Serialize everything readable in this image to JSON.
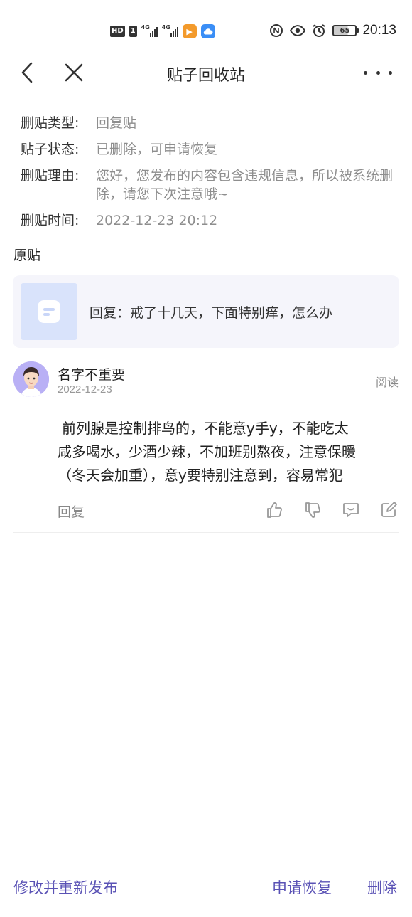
{
  "status_bar": {
    "hd_label": "HD",
    "sim_label": "1",
    "signal_1_label": "4G",
    "signal_2_label": "4G",
    "time": "20:13",
    "battery": "65",
    "icons": [
      "hd-icon",
      "signal-icon",
      "video-app-icon",
      "cloud-icon",
      "nfc-icon",
      "eye-icon",
      "alarm-icon",
      "battery-icon"
    ]
  },
  "nav": {
    "title": "贴子回收站"
  },
  "info": {
    "type_label": "删贴类型:",
    "type_value": "回复贴",
    "status_label": "贴子状态:",
    "status_value": "已删除，可申请恢复",
    "reason_label": "删贴理由:",
    "reason_value": "您好，您发布的内容包含违规信息，所以被系统删除，请您下次注意哦~",
    "time_label": "删贴时间:",
    "time_value": "2022-12-23 20:12"
  },
  "original": {
    "label": "原贴",
    "text": "回复：戒了十几天，下面特别痒，怎么办"
  },
  "reply": {
    "user_name": "名字不重要",
    "date": "2022-12-23",
    "read_label": "阅读",
    "lines": [
      "前列腺是控制排鸟的，不能意y手y，不能吃太",
      "咸多喝水，少酒少辣，不加班别熬夜，注意保暖",
      "（冬天会加重），意y要特别注意到，容易常犯"
    ],
    "reply_label": "回复"
  },
  "bottom": {
    "edit_label": "修改并重新发布",
    "restore_label": "申请恢复",
    "delete_label": "删除"
  },
  "colors": {
    "accent": "#5a52b5",
    "card_bg": "#f5f5fb",
    "thumb_bg": "#d9e3fb",
    "avatar_bg": "#b9b0f5",
    "muted_text": "#8e8e8e"
  }
}
